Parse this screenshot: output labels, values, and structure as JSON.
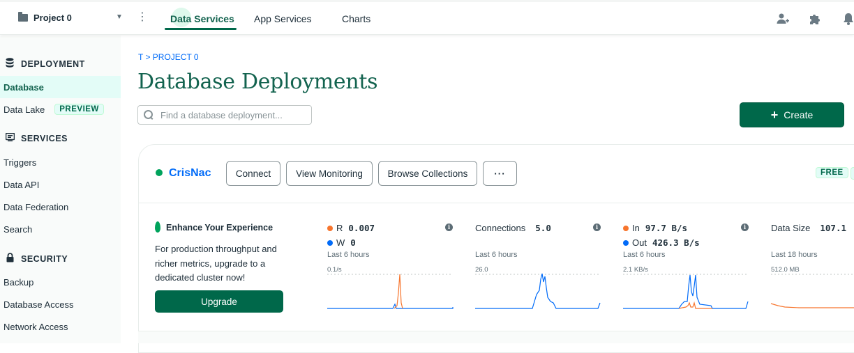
{
  "topbar": {
    "project_name": "Project 0",
    "tabs": [
      {
        "label": "Data Services",
        "active": true
      },
      {
        "label": "App Services",
        "active": false
      },
      {
        "label": "Charts",
        "active": false
      }
    ],
    "icons": [
      "add-user-icon",
      "puzzle-icon",
      "bell-icon"
    ]
  },
  "sidebar": {
    "sections": [
      {
        "heading": "DEPLOYMENT",
        "icon": "database-icon",
        "items": [
          {
            "label": "Database",
            "active": true
          },
          {
            "label": "Data Lake",
            "badge": "PREVIEW"
          }
        ]
      },
      {
        "heading": "SERVICES",
        "icon": "services-icon",
        "items": [
          {
            "label": "Triggers"
          },
          {
            "label": "Data API"
          },
          {
            "label": "Data Federation"
          },
          {
            "label": "Search"
          }
        ]
      },
      {
        "heading": "SECURITY",
        "icon": "lock-icon",
        "items": [
          {
            "label": "Backup"
          },
          {
            "label": "Database Access"
          },
          {
            "label": "Network Access"
          }
        ]
      }
    ]
  },
  "main": {
    "breadcrumb": "T > PROJECT 0",
    "title": "Database Deployments",
    "search_placeholder": "Find a database deployment...",
    "create_label": "Create"
  },
  "cluster": {
    "name": "CrisNac",
    "status_color": "#00a35c",
    "buttons": [
      "Connect",
      "View Monitoring",
      "Browse Collections",
      "···"
    ],
    "tier": "FREE",
    "enhance": {
      "title": "Enhance Your Experience",
      "body": "For production throughput and richer metrics, upgrade to a dedicated cluster now!",
      "button": "Upgrade"
    },
    "metrics": [
      {
        "rows": [
          {
            "label": "R",
            "value": "0.007",
            "dot": "#f7752d"
          },
          {
            "label": "W",
            "value": "0",
            "dot": "#016bf8"
          }
        ],
        "period": "Last 6 hours",
        "scale": "0.1/s"
      },
      {
        "rows": [
          {
            "label": "Connections",
            "value": "5.0"
          }
        ],
        "period": "Last 6 hours",
        "scale": "26.0"
      },
      {
        "rows": [
          {
            "label": "In",
            "value": "97.7 B/s",
            "dot": "#f7752d"
          },
          {
            "label": "Out",
            "value": "426.3 B/s",
            "dot": "#016bf8"
          }
        ],
        "period": "Last 6 hours",
        "scale": "2.1 KB/s"
      },
      {
        "rows": [
          {
            "label": "Data Size",
            "value": "107.1"
          }
        ],
        "period": "Last 18 hours",
        "scale": "512.0 MB"
      }
    ]
  },
  "colors": {
    "brand": "#00684a",
    "link": "#016bf8",
    "orange": "#f7752d",
    "blue": "#016bf8"
  }
}
